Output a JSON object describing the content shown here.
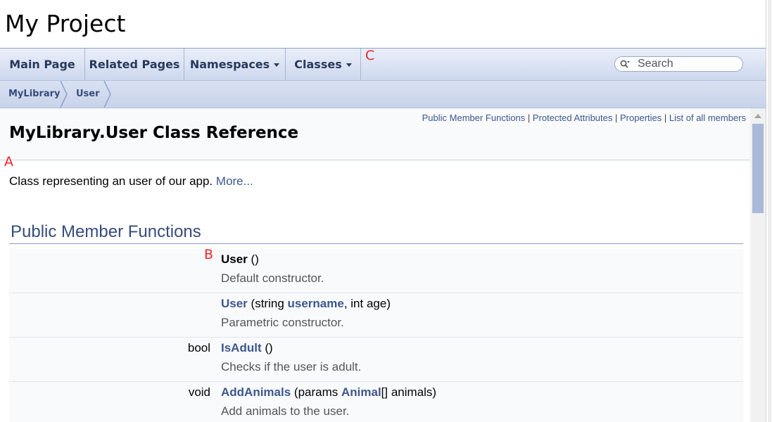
{
  "project": {
    "name": "My Project"
  },
  "nav": {
    "items": [
      {
        "label": "Main Page"
      },
      {
        "label": "Related Pages"
      },
      {
        "label": "Namespaces"
      },
      {
        "label": "Classes"
      }
    ],
    "search_placeholder": "Search"
  },
  "breadcrumb": [
    "MyLibrary",
    "User"
  ],
  "header": {
    "summary_links": [
      "Public Member Functions",
      "Protected Attributes",
      "Properties",
      "List of all members"
    ],
    "summary_separator": "|",
    "title": "MyLibrary.User Class Reference"
  },
  "brief": {
    "text": "Class representing an user of our app.",
    "more": "More..."
  },
  "section": {
    "title": "Public Member Functions",
    "members": [
      {
        "type": "",
        "name": "User",
        "params_before": " ()",
        "param_link": "",
        "params_after": "",
        "desc": "Default constructor."
      },
      {
        "type": "",
        "name": "User",
        "params_before": " (string ",
        "param_link": "username",
        "params_after": ", int age)",
        "desc": "Parametric constructor."
      },
      {
        "type": "bool",
        "name": "IsAdult",
        "params_before": " ()",
        "param_link": "",
        "params_after": "",
        "desc": "Checks if the user is adult."
      },
      {
        "type": "void",
        "name": "AddAnimals",
        "params_before": " (params ",
        "param_link": "Animal",
        "params_after": "[] animals)",
        "desc": "Add animals to the user."
      }
    ]
  },
  "markers": {
    "a": "A",
    "b": "B",
    "c": "C"
  },
  "colors": {
    "link": "#3d578c",
    "heading": "#354c7b",
    "marker": "#e8262a",
    "nav_text": "#283a5d"
  }
}
